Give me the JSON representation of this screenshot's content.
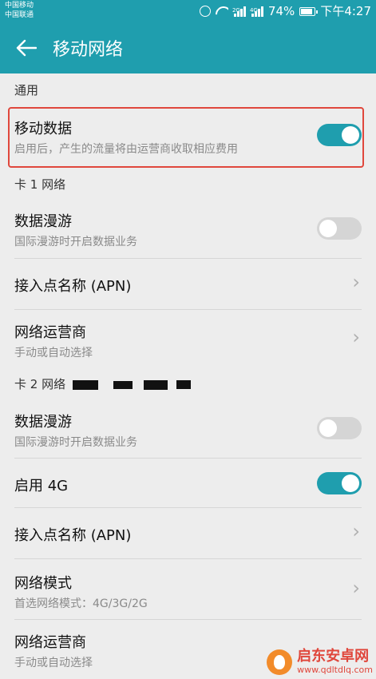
{
  "status_bar": {
    "carrier_1": "中国移动",
    "carrier_2": "中国联通",
    "sim1_tag": "2G",
    "sim2_tag": "4G",
    "battery": "74%",
    "time": "下午4:27"
  },
  "app_bar": {
    "title": "移动网络",
    "back_icon": "arrow-left-icon"
  },
  "general": {
    "header": "通用",
    "mobile_data": {
      "label": "移动数据",
      "description": "启用后，产生的流量将由运营商收取相应费用",
      "enabled": true
    }
  },
  "sim1": {
    "header": "卡 1 网络",
    "roaming": {
      "label": "数据漫游",
      "description": "国际漫游时开启数据业务",
      "enabled": false
    },
    "apn": {
      "label": "接入点名称 (APN)"
    },
    "operator": {
      "label": "网络运营商",
      "description": "手动或自动选择"
    }
  },
  "sim2": {
    "header": "卡 2 网络",
    "roaming": {
      "label": "数据漫游",
      "description": "国际漫游时开启数据业务",
      "enabled": false
    },
    "enable_4g": {
      "label": "启用 4G",
      "enabled": true
    },
    "apn": {
      "label": "接入点名称 (APN)"
    },
    "network_mode": {
      "label": "网络模式",
      "description": "首选网络模式：4G/3G/2G"
    },
    "operator": {
      "label": "网络运营商",
      "description": "手动或自动选择"
    }
  },
  "watermark": {
    "name": "启东安卓网",
    "url": "www.qdltdlq.com"
  },
  "colors": {
    "accent": "#1f9eae",
    "highlight": "#e0473c",
    "background": "#ededed"
  }
}
